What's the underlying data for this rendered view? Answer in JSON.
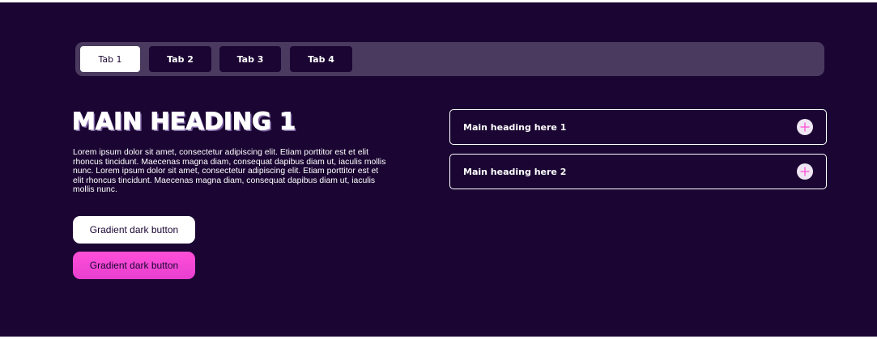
{
  "tabs": [
    {
      "label": "Tab 1",
      "active": true
    },
    {
      "label": "Tab 2",
      "active": false
    },
    {
      "label": "Tab 3",
      "active": false
    },
    {
      "label": "Tab 4",
      "active": false
    }
  ],
  "main": {
    "heading": "MAIN HEADING 1",
    "body": "Lorem ipsum dolor sit amet, consectetur adipiscing elit. Etiam porttitor est et elit rhoncus tincidunt. Maecenas magna diam, consequat dapibus diam ut, iaculis mollis nunc. Lorem ipsum dolor sit amet, consectetur adipiscing elit. Etiam porttitor est et elit rhoncus tincidunt. Maecenas magna diam, consequat dapibus diam ut, iaculis mollis nunc.",
    "buttons": [
      {
        "label": "Gradient dark button",
        "style": "white"
      },
      {
        "label": "Gradient dark button",
        "style": "pink-gradient"
      }
    ]
  },
  "accordion": [
    {
      "label": "Main heading here 1",
      "icon": "plus-icon"
    },
    {
      "label": "Main heading here 2",
      "icon": "plus-icon"
    }
  ],
  "colors": {
    "background": "#1b0633",
    "tab_bar": "#4b3a60",
    "accent_pink": "#ff4fd8",
    "icon_bg": "#efe6f3"
  }
}
